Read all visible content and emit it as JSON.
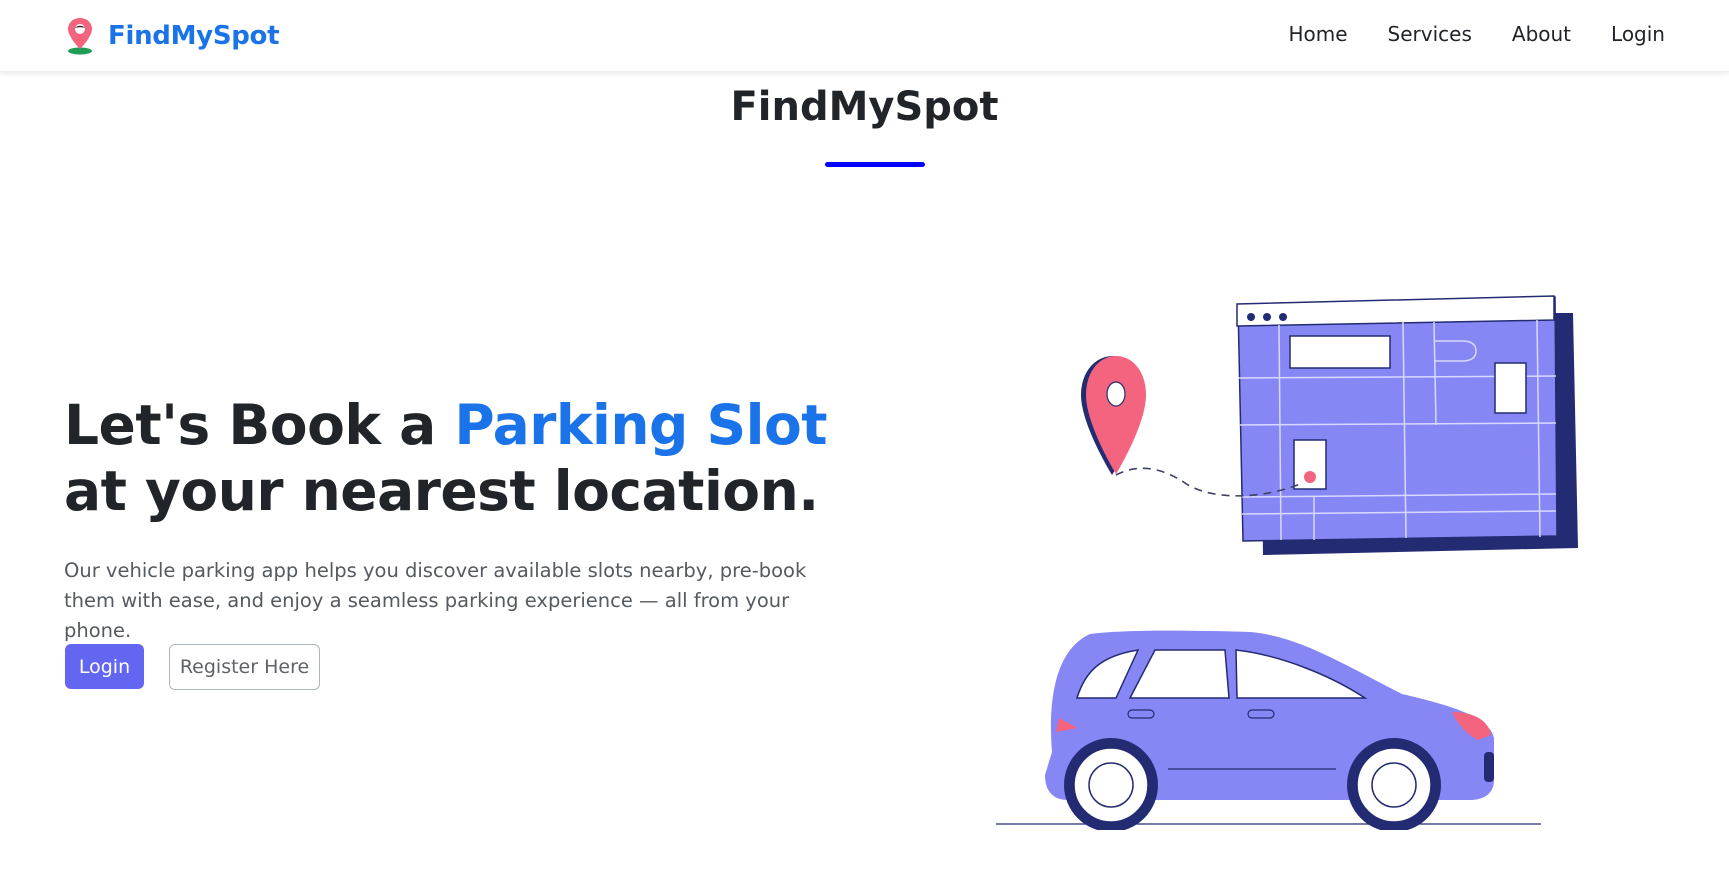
{
  "nav": {
    "brand": "FindMySpot",
    "links": [
      "Home",
      "Services",
      "About",
      "Login"
    ]
  },
  "page_title": "FindMySpot",
  "hero": {
    "heading_part1": "Let's Book a ",
    "heading_accent": "Parking Slot",
    "heading_part2": " at your nearest location.",
    "description": "Our vehicle parking app helps you discover available slots nearby, pre-book them with ease, and enjoy a seamless parking experience — all from your phone.",
    "login_button": "Login",
    "register_button": "Register Here"
  },
  "colors": {
    "brand_blue": "#1a73e8",
    "button_indigo": "#6366f1",
    "underline_blue": "#0000ff",
    "illustration_periwinkle": "#8687f5",
    "illustration_navy": "#232b72",
    "pin_pink": "#f4647f"
  },
  "icons": {
    "brand": "map-pin-icon"
  }
}
